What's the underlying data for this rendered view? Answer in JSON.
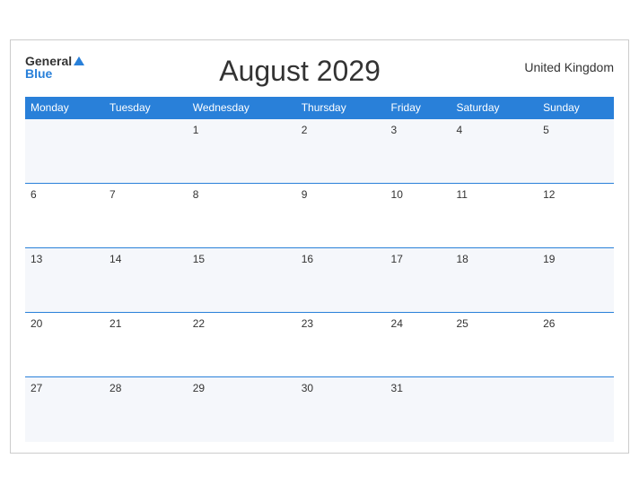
{
  "header": {
    "logo": {
      "general": "General",
      "blue": "Blue",
      "triangle": true
    },
    "title": "August 2029",
    "country": "United Kingdom"
  },
  "columns": [
    "Monday",
    "Tuesday",
    "Wednesday",
    "Thursday",
    "Friday",
    "Saturday",
    "Sunday"
  ],
  "weeks": [
    [
      "",
      "",
      "1",
      "2",
      "3",
      "4",
      "5"
    ],
    [
      "6",
      "7",
      "8",
      "9",
      "10",
      "11",
      "12"
    ],
    [
      "13",
      "14",
      "15",
      "16",
      "17",
      "18",
      "19"
    ],
    [
      "20",
      "21",
      "22",
      "23",
      "24",
      "25",
      "26"
    ],
    [
      "27",
      "28",
      "29",
      "30",
      "31",
      "",
      ""
    ]
  ]
}
